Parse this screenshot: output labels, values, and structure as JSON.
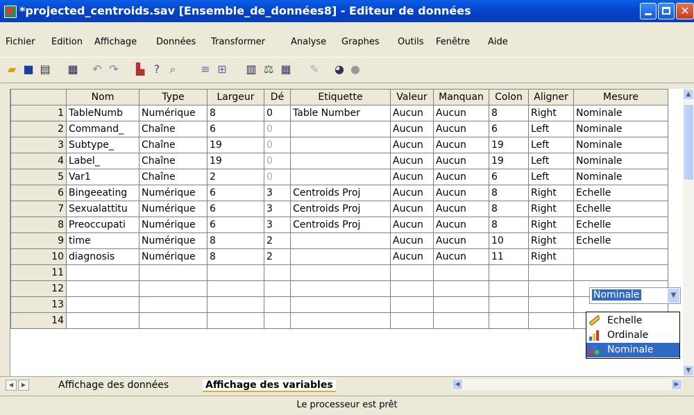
{
  "window": {
    "title": "*projected_centroids.sav [Ensemble_de_données8] - Editeur de données",
    "close_glyph": "✕"
  },
  "menu": [
    "Fichier",
    "Edition",
    "Affichage",
    "Données",
    "Transformer",
    "Analyse",
    "Graphes",
    "Outils",
    "Fenêtre",
    "Aide"
  ],
  "toolbar": {
    "icons": [
      "open-folder-icon",
      "save-icon",
      "print-icon",
      "dialog-recall-icon",
      "undo-icon",
      "redo-icon",
      "goto-case-icon",
      "variables-icon",
      "find-icon",
      "insert-case-icon",
      "insert-variable-icon",
      "split-file-icon",
      "weight-cases-icon",
      "select-cases-icon",
      "value-labels-icon",
      "use-sets-icon",
      "show-all-icon"
    ]
  },
  "grid": {
    "columns": [
      "Nom",
      "Type",
      "Largeur",
      "Dé",
      "Etiquette",
      "Valeur",
      "Manquan",
      "Colon",
      "Aligner",
      "Mesure"
    ],
    "rows": [
      [
        "1",
        "TableNumb",
        "Numérique",
        "8",
        "0",
        "Table Number",
        "Aucun",
        "Aucun",
        "8",
        "Right",
        "Nominale"
      ],
      [
        "2",
        "Command_",
        "Chaîne",
        "6",
        "0",
        "",
        "Aucun",
        "Aucun",
        "6",
        "Left",
        "Nominale"
      ],
      [
        "3",
        "Subtype_",
        "Chaîne",
        "19",
        "0",
        "",
        "Aucun",
        "Aucun",
        "19",
        "Left",
        "Nominale"
      ],
      [
        "4",
        "Label_",
        "Chaîne",
        "19",
        "0",
        "",
        "Aucun",
        "Aucun",
        "19",
        "Left",
        "Nominale"
      ],
      [
        "5",
        "Var1",
        "Chaîne",
        "2",
        "0",
        "",
        "Aucun",
        "Aucun",
        "6",
        "Left",
        "Nominale"
      ],
      [
        "6",
        "Bingeeating",
        "Numérique",
        "6",
        "3",
        "Centroids Proj",
        "Aucun",
        "Aucun",
        "8",
        "Right",
        "Echelle"
      ],
      [
        "7",
        "Sexualattitu",
        "Numérique",
        "6",
        "3",
        "Centroids Proj",
        "Aucun",
        "Aucun",
        "8",
        "Right",
        "Echelle"
      ],
      [
        "8",
        "Preoccupati",
        "Numérique",
        "6",
        "3",
        "Centroids Proj",
        "Aucun",
        "Aucun",
        "8",
        "Right",
        "Echelle"
      ],
      [
        "9",
        "time",
        "Numérique",
        "8",
        "2",
        "",
        "Aucun",
        "Aucun",
        "10",
        "Right",
        "Echelle"
      ],
      [
        "10",
        "diagnosis",
        "Numérique",
        "8",
        "2",
        "",
        "Aucun",
        "Aucun",
        "11",
        "Right",
        ""
      ],
      [
        "11",
        "",
        "",
        "",
        "",
        "",
        "",
        "",
        "",
        "",
        ""
      ],
      [
        "12",
        "",
        "",
        "",
        "",
        "",
        "",
        "",
        "",
        "",
        ""
      ],
      [
        "13",
        "",
        "",
        "",
        "",
        "",
        "",
        "",
        "",
        "",
        ""
      ],
      [
        "14",
        "",
        "",
        "",
        "",
        "",
        "",
        "",
        "",
        "",
        ""
      ]
    ],
    "grayed_decimals_rows": [
      2,
      3,
      4,
      5
    ]
  },
  "measure_editor": {
    "value": "Nominale",
    "options": [
      {
        "label": "Echelle",
        "icon": "ruler-icon"
      },
      {
        "label": "Ordinale",
        "icon": "bar-chart-icon"
      },
      {
        "label": "Nominale",
        "icon": "nominal-circles-icon"
      }
    ],
    "selected_index": 2
  },
  "tabs": {
    "data_view": "Affichage des données",
    "variable_view": "Affichage des variables"
  },
  "status": "Le processeur est prêt",
  "colors": {
    "titlebar": "#0a5fe6",
    "selection": "#316ac5",
    "chrome": "#ece9d8"
  }
}
